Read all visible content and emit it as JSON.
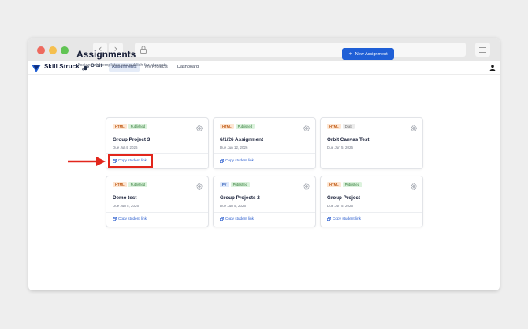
{
  "browser": {
    "back_glyph": "‹",
    "forward_glyph": "›",
    "icons": [
      "lock-icon",
      "hamburger-menu-icon"
    ]
  },
  "app": {
    "brand_name": "Skill Struck",
    "product_label": "Orbit",
    "tabs": [
      {
        "label": "Assignments",
        "active": true
      },
      {
        "label": "My Projects",
        "active": false
      },
      {
        "label": "Dashboard",
        "active": false
      }
    ]
  },
  "page": {
    "title": "Assignments",
    "subtitle": "Assignment templates you publish for students",
    "new_button": {
      "icon": "+",
      "label": "New Assignment"
    }
  },
  "cards": [
    {
      "language": "HTML",
      "status": "Published",
      "title": "Group Project 3",
      "due": "Due Jul 4, 2026",
      "link": "Copy student link"
    },
    {
      "language": "HTML",
      "status": "Published",
      "title": "6/1/26 Assignment",
      "due": "Due Jun 12, 2026",
      "link": "Copy student link"
    },
    {
      "language": "HTML",
      "status": "Draft",
      "title": "Orbit Canvas Test",
      "due": "Due Jun 5, 2026",
      "link": ""
    },
    {
      "language": "HTML",
      "status": "Published",
      "title": "Demo test",
      "due": "Due Jun 5, 2026",
      "link": "Copy student link"
    },
    {
      "language": "PY",
      "status": "Published",
      "title": "Group Projects 2",
      "due": "Due Jun 5, 2026",
      "link": "Copy student link"
    },
    {
      "language": "HTML",
      "status": "Published",
      "title": "Group Project",
      "due": "Due Jun 5, 2026",
      "link": "Copy student link"
    }
  ],
  "colors": {
    "accent": "#1f5fd6",
    "annotation": "#e2261c",
    "html_badge": "#c05a14",
    "py_badge": "#2a59b5",
    "published_badge": "#2f7a36"
  }
}
